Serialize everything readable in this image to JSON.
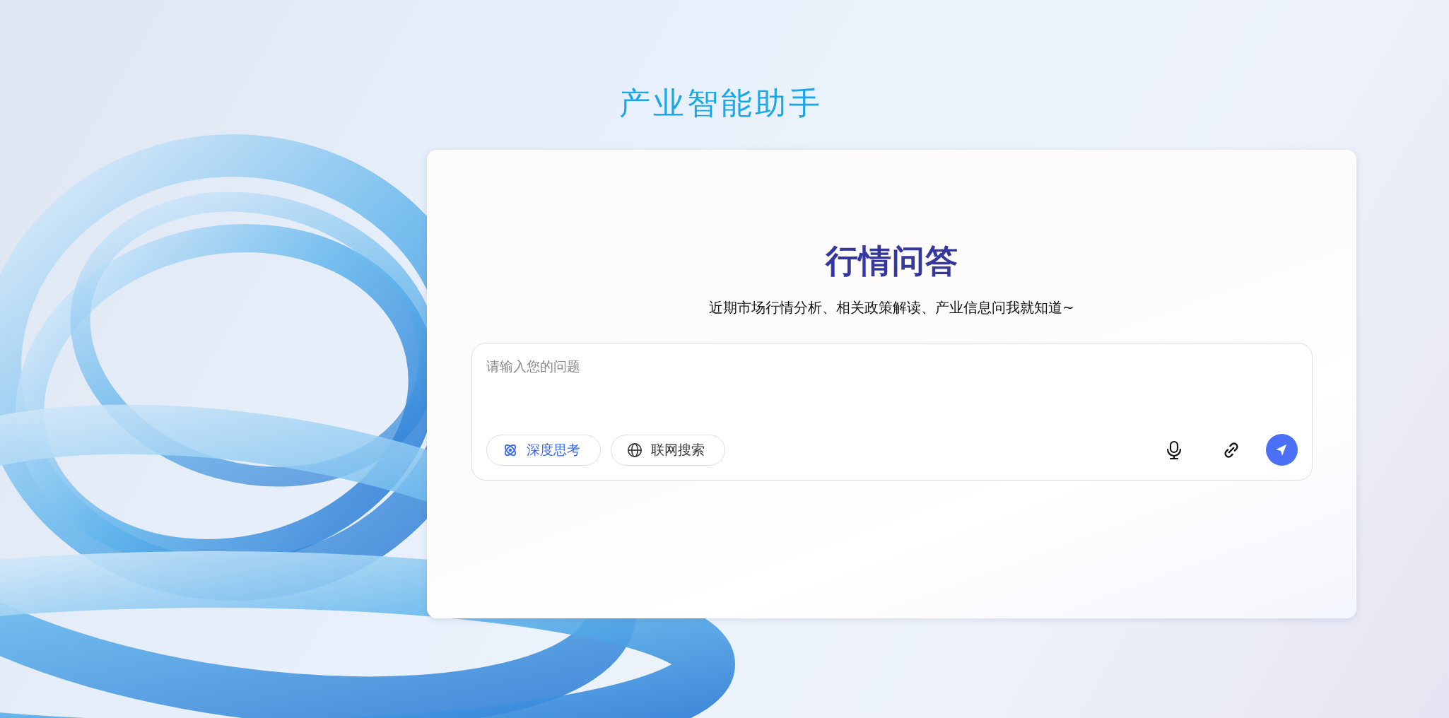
{
  "app_title": "产业智能助手",
  "card": {
    "title": "行情问答",
    "subtitle": "近期市场行情分析、相关政策解读、产业信息问我就知道~",
    "input": {
      "placeholder": "请输入您的问题"
    },
    "toggles": [
      {
        "kind": "deep-think",
        "label": "深度思考",
        "selected": true
      },
      {
        "kind": "web-search",
        "label": "联网搜索",
        "selected": false
      }
    ]
  }
}
